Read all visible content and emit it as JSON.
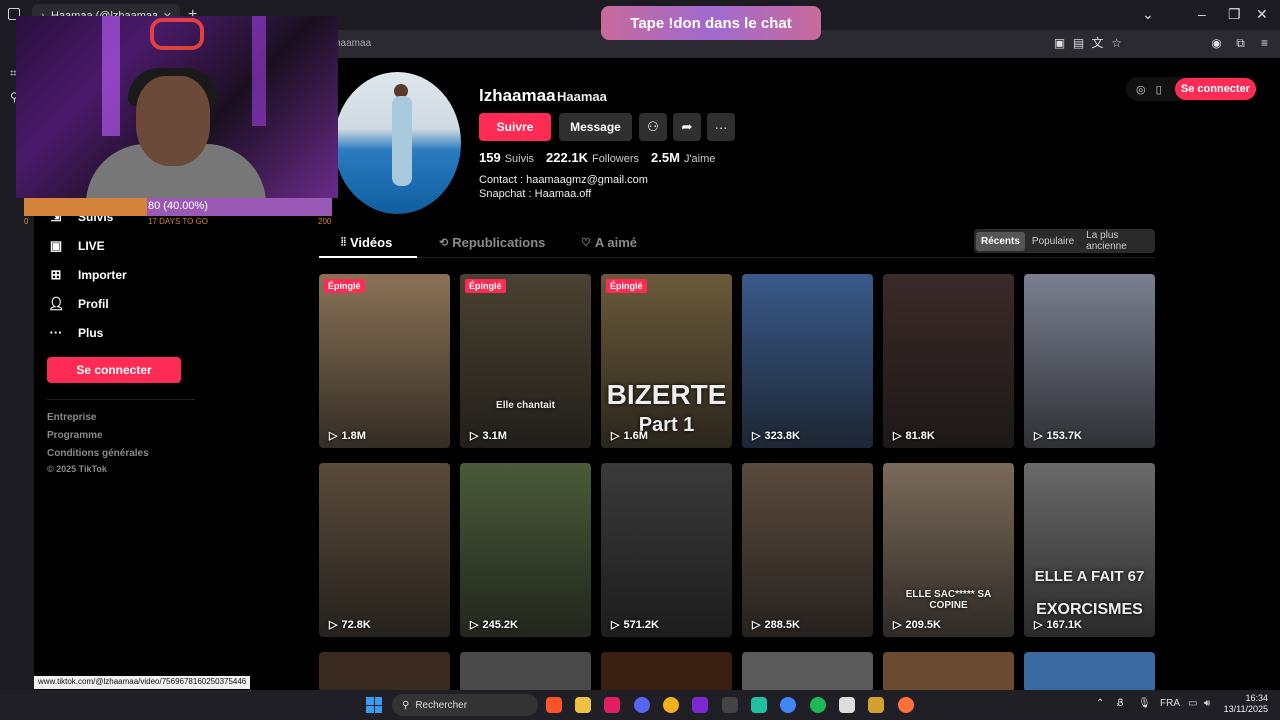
{
  "browser": {
    "tab_title": "Haamaa (@lzhaamaa) | TikTok",
    "url": "haamaa",
    "status_url": "www.tiktok.com/@lzhaamaa/video/7569678160250375446"
  },
  "stream_overlay": {
    "chat_banner": "Tape !don dans le chat",
    "progress_text": "80 (40.00%)",
    "progress_fraction": 0.4,
    "progress_min": "0",
    "progress_max": "200",
    "progress_days": "17 DAYS TO GO"
  },
  "nav": {
    "items": [
      {
        "label": "Suivis",
        "icon": "users-icon"
      },
      {
        "label": "LIVE",
        "icon": "live-icon"
      },
      {
        "label": "Importer",
        "icon": "upload-icon"
      },
      {
        "label": "Profil",
        "icon": "profile-icon"
      },
      {
        "label": "Plus",
        "icon": "more-icon"
      }
    ],
    "login_label": "Se connecter",
    "footer": [
      "Entreprise",
      "Programme",
      "Conditions générales",
      "© 2025 TikTok"
    ]
  },
  "profile": {
    "username": "lzhaamaa",
    "nickname": "Haamaa",
    "follow_label": "Suivre",
    "message_label": "Message",
    "stats": [
      {
        "value": "159",
        "label": "Suivis"
      },
      {
        "value": "222.1K",
        "label": "Followers"
      },
      {
        "value": "2.5M",
        "label": "J'aime"
      }
    ],
    "bio": [
      "Contact : haamaagmz@gmail.com",
      "Snapchat : Haamaa.off"
    ]
  },
  "top_right": {
    "login_label": "Se connecter"
  },
  "tabs": [
    "Vidéos",
    "Republications",
    "A aimé"
  ],
  "sort": [
    "Récents",
    "Populaire",
    "La plus ancienne"
  ],
  "pin_label": "Épinglé",
  "videos": [
    {
      "views": "1.8M",
      "pinned": true,
      "color": "#8a7256"
    },
    {
      "views": "3.1M",
      "pinned": true,
      "color": "#4a4232",
      "caption": "Elle chantait"
    },
    {
      "views": "1.6M",
      "pinned": true,
      "color": "#6a5a3a",
      "overlay": "BIZERTE",
      "overlay2": "Part 1"
    },
    {
      "views": "323.8K",
      "pinned": false,
      "color": "#3a5a8a"
    },
    {
      "views": "81.8K",
      "pinned": false,
      "color": "#3a2a28"
    },
    {
      "views": "153.7K",
      "pinned": false,
      "color": "#7a8090"
    },
    {
      "views": "72.8K",
      "pinned": false,
      "color": "#5a4a3a"
    },
    {
      "views": "245.2K",
      "pinned": false,
      "color": "#4a5a3a"
    },
    {
      "views": "571.2K",
      "pinned": false,
      "color": "#3a3a3a"
    },
    {
      "views": "288.5K",
      "pinned": false,
      "color": "#5a4a3e"
    },
    {
      "views": "209.5K",
      "pinned": false,
      "color": "#7a6a5a",
      "caption": "ELLE SAC***** SA COPINE"
    },
    {
      "views": "167.1K",
      "pinned": false,
      "color": "#6a6a6a",
      "overlay": "ELLE A FAIT 67",
      "overlay2": "EXORCISMES"
    }
  ],
  "taskbar": {
    "search": "Rechercher",
    "lang": "FRA",
    "time": "16:34",
    "date": "13/11/2025"
  }
}
